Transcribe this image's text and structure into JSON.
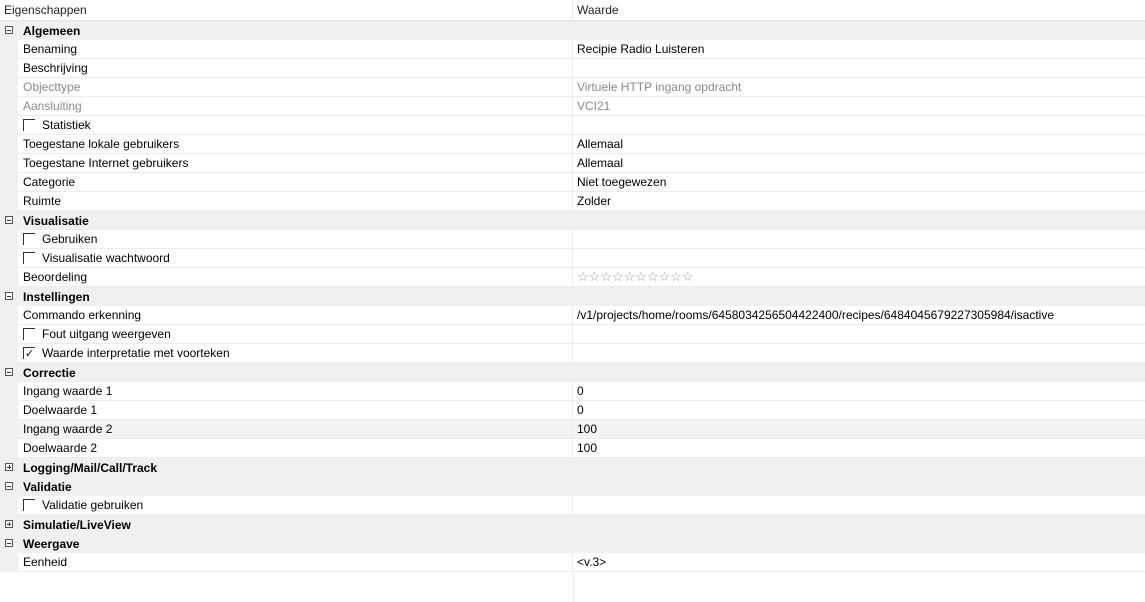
{
  "header": {
    "col_property": "Eigenschappen",
    "col_value": "Waarde"
  },
  "rows": [
    {
      "type": "category",
      "label": "Algemeen",
      "expanded": true
    },
    {
      "label": "Benaming",
      "value": "Recipie Radio Luisteren"
    },
    {
      "label": "Beschrijving",
      "value": ""
    },
    {
      "label": "Objecttype",
      "value": "Virtuele HTTP ingang opdracht",
      "disabled": true
    },
    {
      "label": "Aansluiting",
      "value": "VCI21",
      "disabled": true
    },
    {
      "label": "Statistiek",
      "value": "",
      "checkbox": true,
      "checked": false
    },
    {
      "label": "Toegestane lokale gebruikers",
      "value": "Allemaal"
    },
    {
      "label": "Toegestane Internet gebruikers",
      "value": "Allemaal"
    },
    {
      "label": "Categorie",
      "value": "Niet toegewezen"
    },
    {
      "label": "Ruimte",
      "value": "Zolder"
    },
    {
      "type": "category",
      "label": "Visualisatie",
      "expanded": true
    },
    {
      "label": "Gebruiken",
      "value": "",
      "checkbox": true,
      "checked": false
    },
    {
      "label": "Visualisatie wachtwoord",
      "value": "",
      "checkbox": true,
      "checked": false
    },
    {
      "label": "Beoordeling",
      "value": "",
      "rating": {
        "stars": 10,
        "filled": 0
      }
    },
    {
      "type": "category",
      "label": "Instellingen",
      "expanded": true
    },
    {
      "label": "Commando erkenning",
      "value": "/v1/projects/home/rooms/6458034256504422400/recipes/6484045679227305984/isactive"
    },
    {
      "label": "Fout uitgang weergeven",
      "value": "",
      "checkbox": true,
      "checked": false
    },
    {
      "label": "Waarde interpretatie met voorteken",
      "value": "",
      "checkbox": true,
      "checked": true
    },
    {
      "type": "category",
      "label": "Correctie",
      "expanded": true
    },
    {
      "label": "Ingang waarde 1",
      "value": "0"
    },
    {
      "label": "Doelwaarde 1",
      "value": "0"
    },
    {
      "label": "Ingang waarde 2",
      "value": "100",
      "highlight": true
    },
    {
      "label": "Doelwaarde 2",
      "value": "100"
    },
    {
      "type": "category",
      "label": "Logging/Mail/Call/Track",
      "expanded": false
    },
    {
      "type": "category",
      "label": "Validatie",
      "expanded": true
    },
    {
      "label": "Validatie gebruiken",
      "value": "",
      "checkbox": true,
      "checked": false
    },
    {
      "type": "category",
      "label": "Simulatie/LiveView",
      "expanded": false
    },
    {
      "type": "category",
      "label": "Weergave",
      "expanded": true
    },
    {
      "label": "Eenheid",
      "value": "<v.3>"
    }
  ]
}
